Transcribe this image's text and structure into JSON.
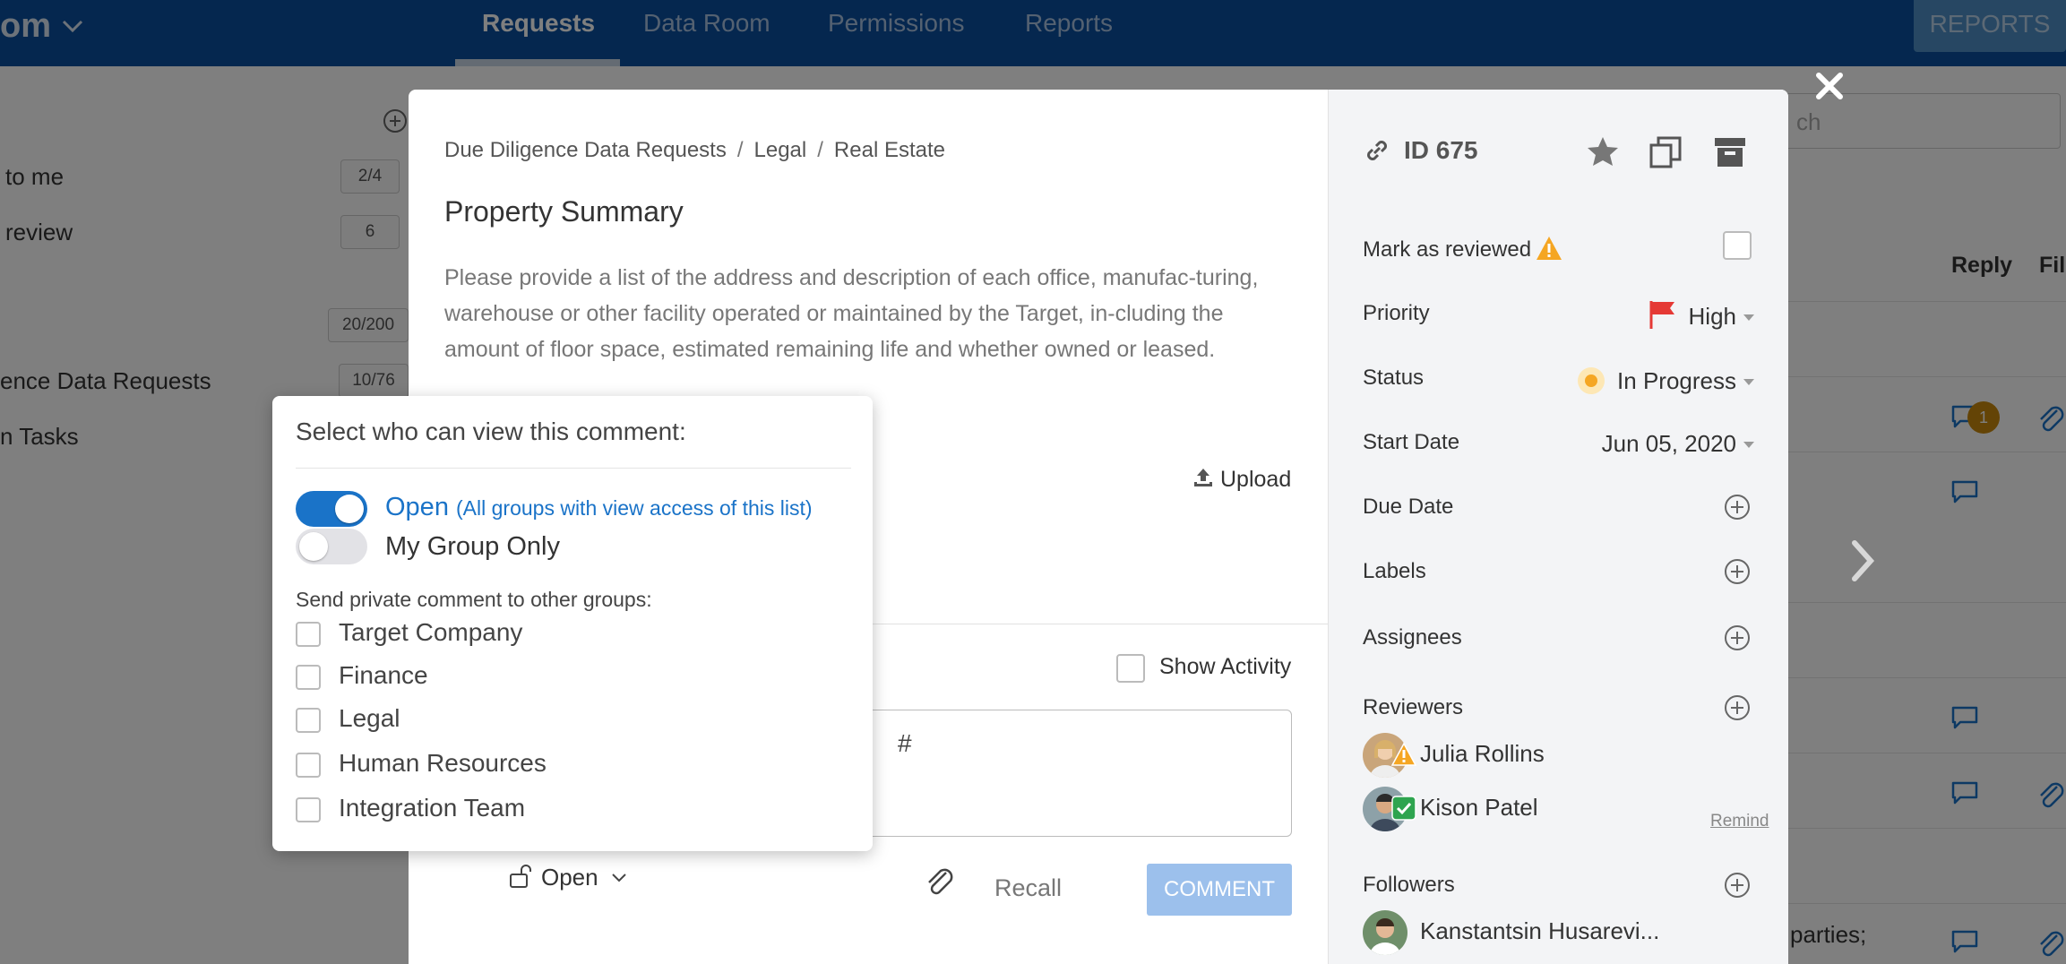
{
  "app": {
    "brand": "om",
    "nav_tabs": [
      "Requests",
      "Data Room",
      "Permissions",
      "Reports"
    ],
    "reports_button": "REPORTS"
  },
  "background": {
    "left_items": [
      {
        "label": "to me",
        "count": "2/4"
      },
      {
        "label": "review",
        "count": "6"
      },
      {
        "label": "",
        "count": "20/200"
      },
      {
        "label": "ence Data Requests",
        "count": "10/76"
      },
      {
        "label": "n Tasks",
        "count": ""
      }
    ],
    "search_placeholder": "ch",
    "columns": [
      "Reply",
      "Fil"
    ],
    "reply_badge": "1",
    "partial_text": "parties;"
  },
  "modal": {
    "breadcrumb": [
      "Due Diligence Data Requests",
      "Legal",
      "Real Estate"
    ],
    "title": "Property Summary",
    "description": "Please provide a list of the address and description of each office, manufac-turing, warehouse or other facility operated or maintained by the Target, in-cluding the amount of floor space, estimated remaining life and whether owned or leased.",
    "upload_label": "Upload",
    "show_activity_label": "Show Activity",
    "comment_input_value": "#",
    "visibility_label": "Open",
    "recall_label": "Recall",
    "comment_button": "COMMENT"
  },
  "details": {
    "id_label": "ID 675",
    "mark_reviewed_label": "Mark as reviewed",
    "priority_label": "Priority",
    "priority_value": "High",
    "status_label": "Status",
    "status_value": "In Progress",
    "start_date_label": "Start Date",
    "start_date_value": "Jun 05, 2020",
    "due_date_label": "Due Date",
    "labels_label": "Labels",
    "assignees_label": "Assignees",
    "reviewers_label": "Reviewers",
    "reviewers": [
      {
        "name": "Julia Rollins",
        "badge": "warning"
      },
      {
        "name": "Kison Patel",
        "badge": "approved"
      }
    ],
    "remind_link": "Remind",
    "followers_label": "Followers",
    "followers": [
      {
        "name": "Kanstantsin Husarevi..."
      }
    ]
  },
  "popover": {
    "title": "Select who can view this comment:",
    "option_open": "Open",
    "option_open_sub": "(All groups with view access of this list)",
    "option_open_on": true,
    "option_group": "My Group Only",
    "option_group_on": false,
    "private_label": "Send private comment to other groups:",
    "groups": [
      "Target Company",
      "Finance",
      "Legal",
      "Human Resources",
      "Integration Team"
    ]
  },
  "colors": {
    "topbar": "#0a4f9e",
    "accent": "#1a73c8",
    "comment_button": "#9cc0ec",
    "priority_flag": "#e53935",
    "status_dot": "#f5a623",
    "warning": "#f5a623"
  }
}
